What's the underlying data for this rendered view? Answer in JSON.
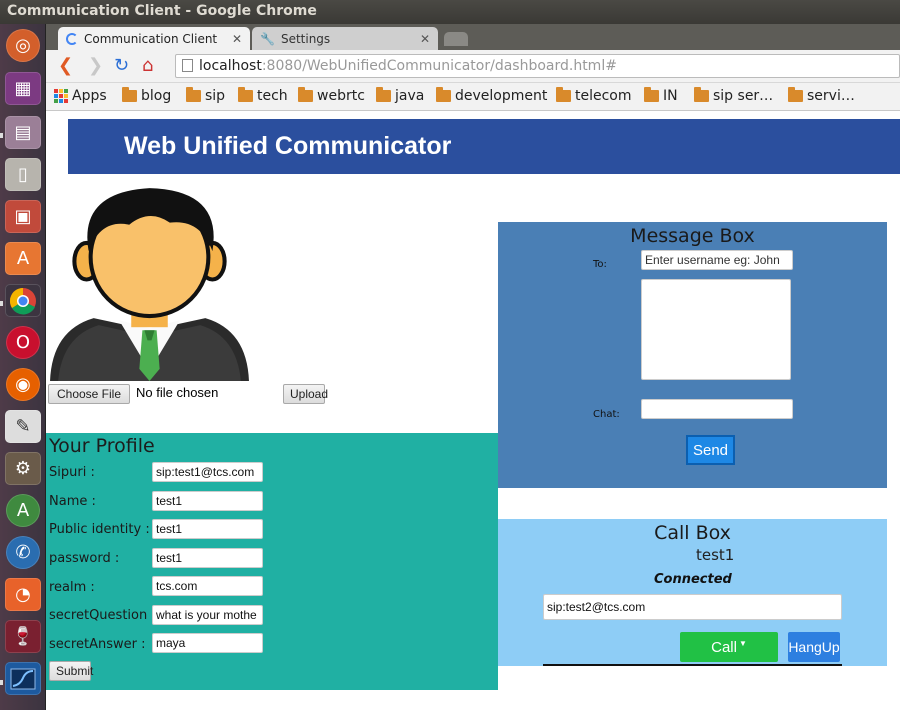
{
  "window": {
    "title": "Communication Client - Google Chrome"
  },
  "tabs": [
    {
      "label": "Communication Client",
      "icon": "loading-spinner-icon"
    },
    {
      "label": "Settings",
      "icon": "wrench-icon"
    }
  ],
  "address": {
    "host": "localhost",
    "rest": ":8080/WebUnifiedCommunicator/dashboard.html#"
  },
  "bookmarks": {
    "apps": "Apps",
    "items": [
      "blog",
      "sip",
      "tech",
      "webrtc",
      "java",
      "development",
      "telecom",
      "IN",
      "sip ser…",
      "servi…"
    ]
  },
  "header": {
    "title": "Web Unified Communicator"
  },
  "upload": {
    "choose_label": "Choose File",
    "status": "No file chosen",
    "upload_label": "Upload"
  },
  "profile": {
    "title": "Your Profile",
    "fields": [
      {
        "label": "Sipuri :",
        "value": "sip:test1@tcs.com"
      },
      {
        "label": "Name :",
        "value": "test1"
      },
      {
        "label": "Public identity :",
        "value": "test1"
      },
      {
        "label": "password :",
        "value": "test1"
      },
      {
        "label": "realm :",
        "value": "tcs.com"
      },
      {
        "label": "secretQuestion :",
        "value": "what is your mothe"
      },
      {
        "label": "secretAnswer :",
        "value": "maya"
      }
    ],
    "submit_label": "Submit"
  },
  "message_box": {
    "title": "Message Box",
    "to_label": "To:",
    "to_placeholder": "Enter username eg: John",
    "chat_label": "Chat:",
    "send_label": "Send"
  },
  "call_box": {
    "title": "Call Box",
    "user": "test1",
    "status": "Connected",
    "target": "sip:test2@tcs.com",
    "call_label": "Call",
    "hangup_label": "HangUp"
  },
  "colors": {
    "header": "#2b4f9e",
    "profile": "#20b0a3",
    "message_box": "#4a7fb5",
    "call_box": "#8ecdf6",
    "call_button": "#21c145",
    "hangup_button": "#2d7fe0",
    "send_button": "#1e88e5"
  }
}
